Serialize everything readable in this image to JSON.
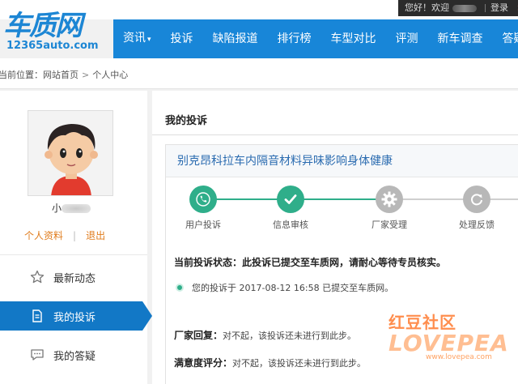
{
  "topbar": {
    "greeting": "您好！欢迎",
    "login": "登录",
    "close": "×"
  },
  "logo": {
    "cn": "车质网",
    "url": "12365auto.com"
  },
  "nav": [
    {
      "label": "资讯",
      "caret": "▾"
    },
    {
      "label": "投诉"
    },
    {
      "label": "缺陷报道"
    },
    {
      "label": "排行榜"
    },
    {
      "label": "车型对比"
    },
    {
      "label": "评测"
    },
    {
      "label": "新车调查"
    },
    {
      "label": "答疑"
    }
  ],
  "breadcrumb": {
    "prefix": "当前位置：",
    "home": "网站首页",
    "sep": ">",
    "current": "个人中心"
  },
  "user": {
    "name_prefix": "小",
    "profile_link": "个人资料",
    "bar": "|",
    "logout_link": "退出"
  },
  "sidebar": {
    "items": [
      {
        "label": "最新动态",
        "icon": "star-icon"
      },
      {
        "label": "我的投诉",
        "icon": "document-icon",
        "active": true
      },
      {
        "label": "我的答疑",
        "icon": "chat-icon"
      }
    ]
  },
  "content": {
    "title": "我的投诉",
    "complaint_title": "别克昂科拉车内隔音材料异味影响身体健康",
    "steps": [
      {
        "label": "用户投诉",
        "state": "done",
        "icon": "phone-icon"
      },
      {
        "label": "信息审核",
        "state": "done",
        "icon": "check-icon"
      },
      {
        "label": "厂家受理",
        "state": "pending",
        "icon": "gear-icon"
      },
      {
        "label": "处理反馈",
        "state": "pending",
        "icon": "refresh-icon"
      }
    ],
    "status_label": "当前投诉状态：",
    "status_text": "此投诉已提交至车质网，请耐心等待专员核实。",
    "timeline_text": "您的投诉于 2017-08-12 16:58 已提交至车质网。",
    "factory_reply_label": "厂家回复：",
    "factory_reply_text": "对不起，该投诉还未进行到此步。",
    "satisfaction_label": "满意度评分：",
    "satisfaction_text": "对不起，该投诉还未进行到此步。"
  },
  "watermark": {
    "cn": "红豆社区",
    "logo": "LOVEPEA",
    "url": "www.lovepea.com"
  },
  "colors": {
    "brand_blue": "#1886d8",
    "active_blue": "#1278c6",
    "done_green": "#2fae8a",
    "pending_gray": "#b8b8b8",
    "link_orange": "#e07c1d"
  }
}
